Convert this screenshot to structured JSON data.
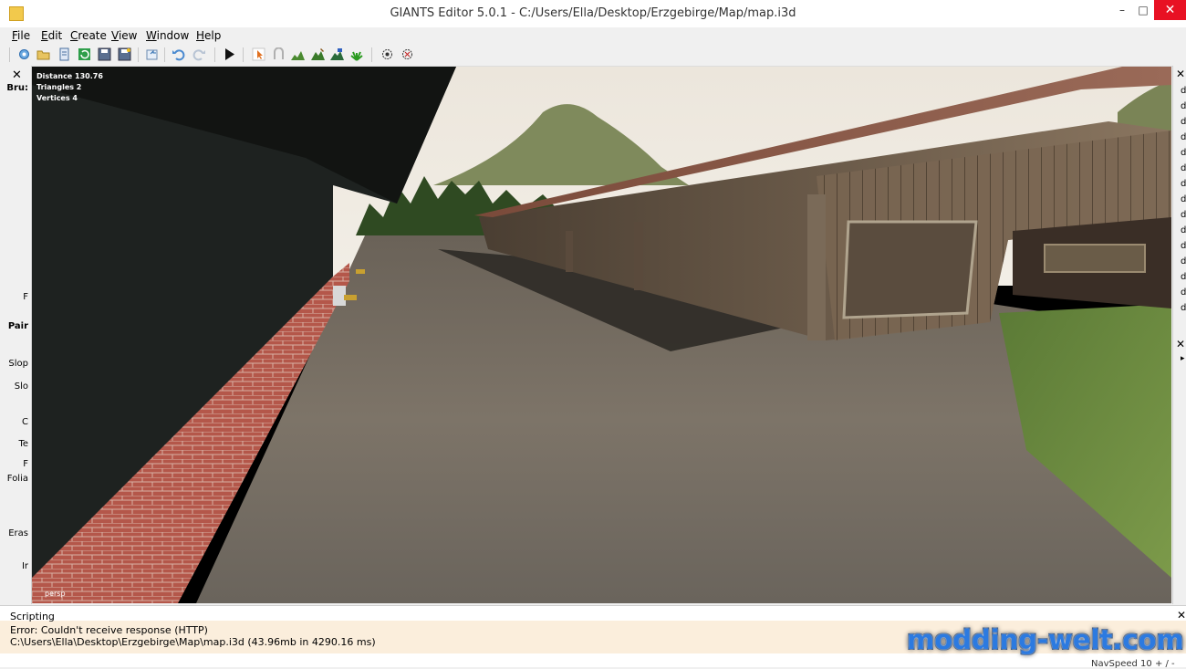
{
  "window": {
    "title": "GIANTS Editor 5.0.1 - C:/Users/Ella/Desktop/Erzgebirge/Map/map.i3d",
    "minimize_glyph": "–",
    "maximize_glyph": "□",
    "close_glyph": "✕"
  },
  "menu": {
    "items": [
      {
        "label": "File"
      },
      {
        "label": "Edit"
      },
      {
        "label": "Create"
      },
      {
        "label": "View"
      },
      {
        "label": "Window"
      },
      {
        "label": "Help"
      }
    ]
  },
  "toolbar": {
    "icons": [
      "new-icon",
      "open-icon",
      "import-icon",
      "refresh-icon",
      "save-icon",
      "save-as-icon",
      "export-icon",
      "undo-icon",
      "redo-icon",
      "play-icon",
      "select-icon",
      "move-icon",
      "terrain-sculpt-icon",
      "terrain-paint-icon",
      "terrain-smooth-icon",
      "foliage-paint-icon",
      "pick-icon",
      "snap-icon"
    ]
  },
  "left_panel": {
    "close_glyph": "✕",
    "labels": [
      {
        "text": "Bru:",
        "bold": true
      },
      {
        "text": "F",
        "bold": false
      },
      {
        "text": "Pair",
        "bold": true
      },
      {
        "text": "Slop",
        "bold": false
      },
      {
        "text": "Slo",
        "bold": false
      },
      {
        "text": "C",
        "bold": false
      },
      {
        "text": "Te",
        "bold": false
      },
      {
        "text": "F",
        "bold": false
      },
      {
        "text": "Folia",
        "bold": false
      },
      {
        "text": "Eras",
        "bold": false
      },
      {
        "text": "Ir",
        "bold": false
      }
    ]
  },
  "viewport": {
    "stats": {
      "distance": "Distance 130.76",
      "triangles": "Triangles 2",
      "vertices": "Vertices 4"
    },
    "camera": "persp"
  },
  "right_panel": {
    "close_glyph": "✕",
    "row_glyph": "d",
    "arrow_glyph": "▸"
  },
  "scripting": {
    "title": "Scripting",
    "close_glyph": "✕",
    "lines": [
      "Error: Couldn't receive response (HTTP)",
      "C:\\Users\\Ella\\Desktop\\Erzgebirge\\Map\\map.i3d (43.96mb in 4290.16 ms)"
    ]
  },
  "status": {
    "navspeed": "NavSpeed 10 + / -"
  },
  "watermark": "modding-welt.com",
  "colors": {
    "close_button": "#e81123",
    "watermark": "#2c7ae0"
  }
}
